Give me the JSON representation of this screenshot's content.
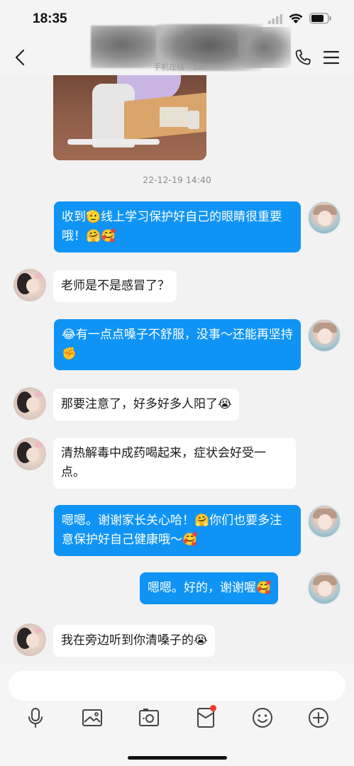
{
  "status_bar": {
    "time": "18:35"
  },
  "header": {
    "contact_status": "手机在线 - 5G"
  },
  "chat": {
    "timestamp": "22-12-19 14:40",
    "messages": [
      {
        "sender": "self",
        "text": "收到🫡线上学习保护好自己的眼睛很重要哦！🤗🥰"
      },
      {
        "sender": "peer",
        "text": "老师是不是感冒了？"
      },
      {
        "sender": "self",
        "text": "😂有一点点嗓子不舒服，没事～还能再坚持✊"
      },
      {
        "sender": "peer",
        "text": "那要注意了，好多好多人阳了😭"
      },
      {
        "sender": "peer",
        "text": "清热解毒中成药喝起来，症状会好受一点。"
      },
      {
        "sender": "self",
        "text": "嗯嗯。谢谢家长关心哈！🤗你们也要多注意保护好自己健康哦～🥰"
      },
      {
        "sender": "self",
        "text": "嗯嗯。好的，谢谢喔🥰"
      },
      {
        "sender": "peer",
        "text": "我在旁边听到你清嗓子的😭"
      }
    ]
  },
  "input": {
    "value": "",
    "placeholder": ""
  },
  "toolbar": {
    "icons": [
      "microphone-icon",
      "image-icon",
      "camera-icon",
      "red-packet-icon",
      "emoji-icon",
      "plus-icon"
    ],
    "notification_dot_color": "#f2392c"
  },
  "colors": {
    "self_bubble": "#0f94f6",
    "peer_bubble": "#ffffff",
    "background": "#f2f2f2"
  }
}
